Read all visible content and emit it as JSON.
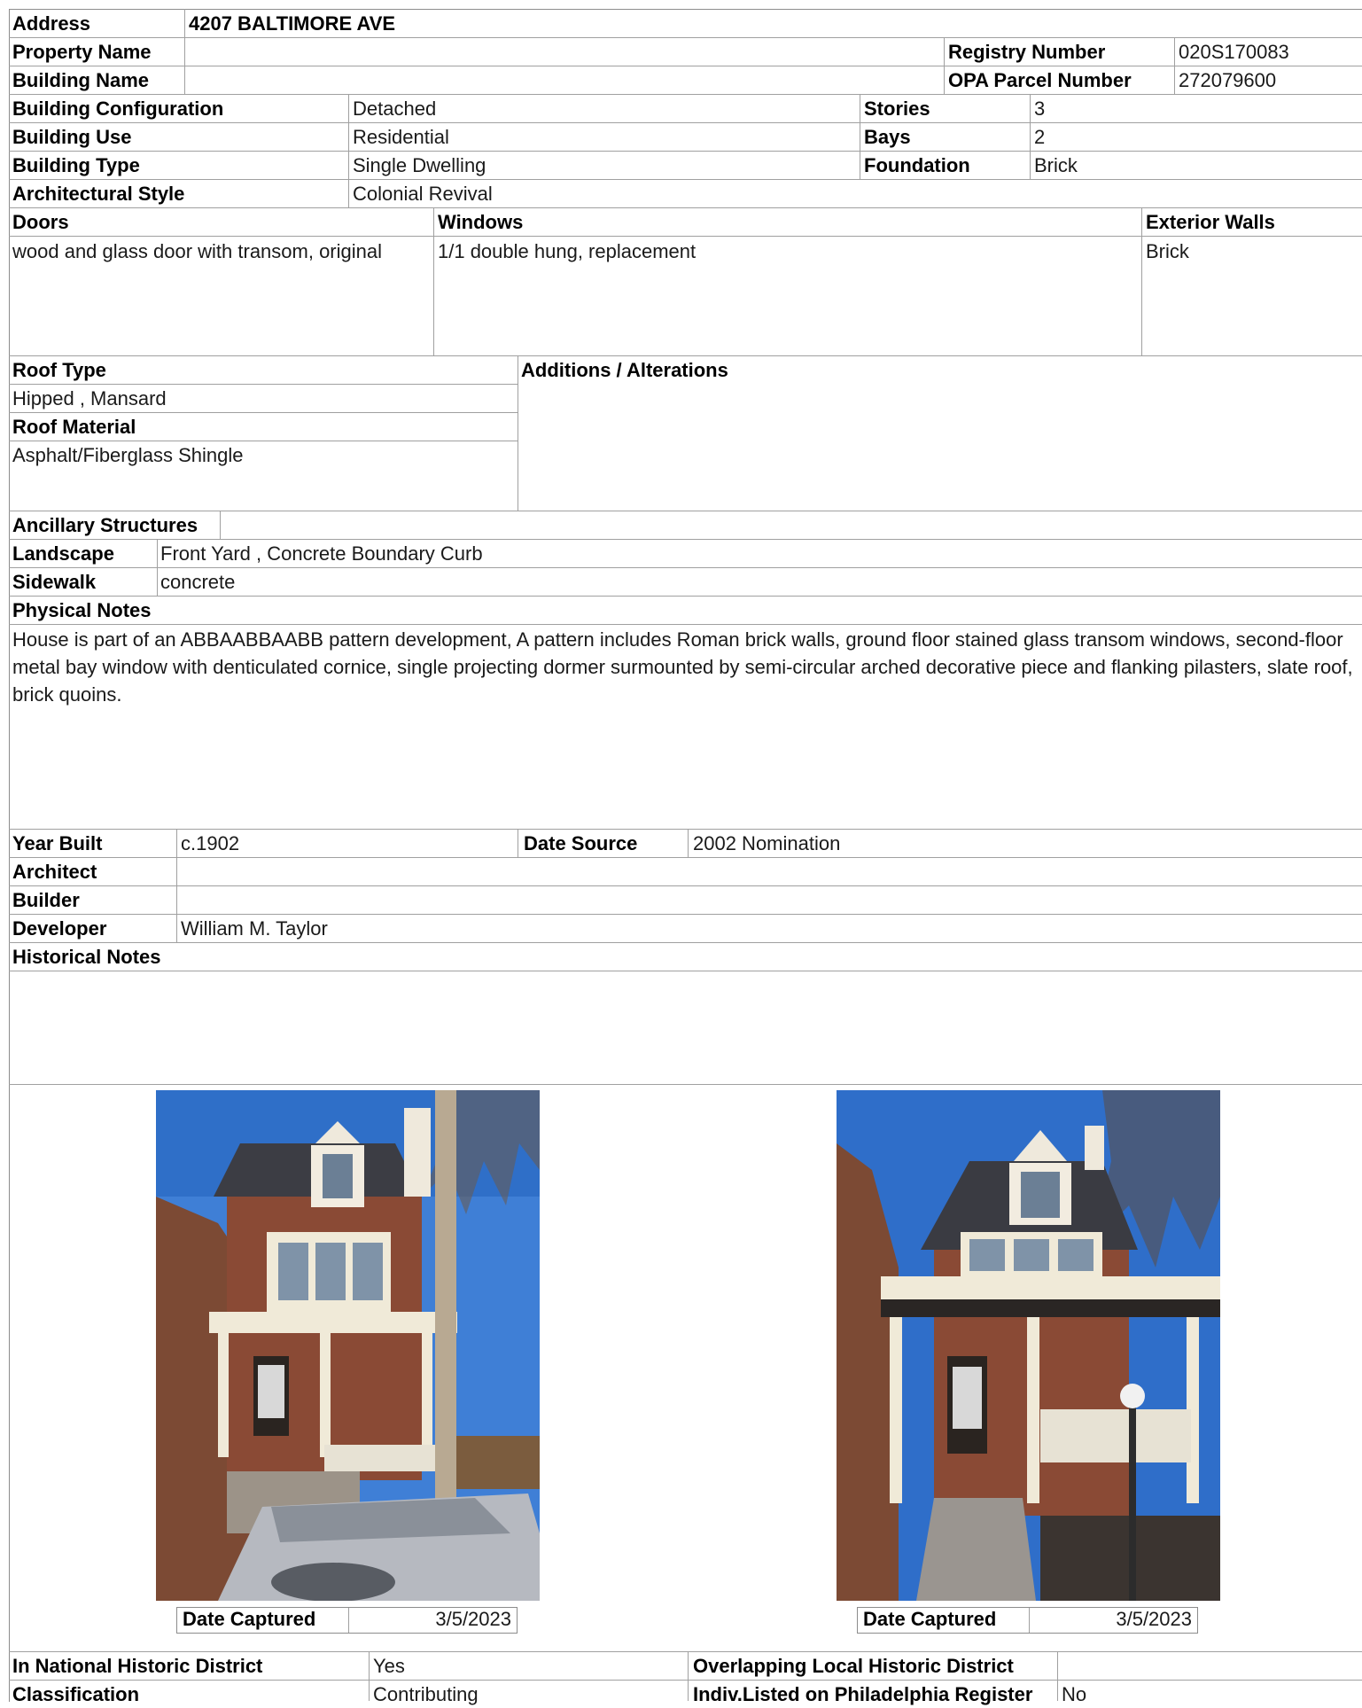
{
  "property": {
    "address_label": "Address",
    "address_value": "4207 BALTIMORE AVE",
    "property_name_label": "Property Name",
    "property_name_value": "",
    "registry_number_label": "Registry Number",
    "registry_number_value": "020S170083",
    "building_name_label": "Building Name",
    "building_name_value": "",
    "opa_parcel_label": "OPA Parcel Number",
    "opa_parcel_value": "272079600"
  },
  "building": {
    "configuration_label": "Building Configuration",
    "configuration_value": "Detached",
    "stories_label": "Stories",
    "stories_value": "3",
    "use_label": "Building Use",
    "use_value": "Residential",
    "bays_label": "Bays",
    "bays_value": "2",
    "type_label": "Building Type",
    "type_value": "Single Dwelling",
    "foundation_label": "Foundation",
    "foundation_value": "Brick",
    "style_label": "Architectural Style",
    "style_value": "Colonial Revival"
  },
  "features": {
    "doors_label": "Doors",
    "doors_value": "wood and glass door with transom, original",
    "windows_label": "Windows",
    "windows_value": "1/1 double hung, replacement",
    "walls_label": "Exterior Walls",
    "walls_value": "Brick"
  },
  "roof": {
    "type_label": "Roof Type",
    "type_value": "Hipped , Mansard",
    "material_label": "Roof Material",
    "material_value": "Asphalt/Fiberglass Shingle",
    "additions_label": "Additions / Alterations",
    "additions_value": ""
  },
  "site": {
    "ancillary_label": "Ancillary Structures",
    "ancillary_value": "",
    "landscape_label": "Landscape",
    "landscape_value": "Front Yard , Concrete Boundary Curb",
    "sidewalk_label": "Sidewalk",
    "sidewalk_value": "concrete"
  },
  "physical_notes": {
    "label": "Physical Notes",
    "text": "House is part of an ABBAABBAABB pattern development, A pattern includes Roman brick walls, ground floor stained glass transom windows, second-floor metal bay window with denticulated cornice, single projecting dormer surmounted by semi-circular arched decorative piece and flanking pilasters, slate roof, brick quoins."
  },
  "history": {
    "year_built_label": "Year Built",
    "year_built_value": "c.1902",
    "date_source_label": "Date Source",
    "date_source_value": "2002 Nomination",
    "architect_label": "Architect",
    "architect_value": "",
    "builder_label": "Builder",
    "builder_value": "",
    "developer_label": "Developer",
    "developer_value": "William M. Taylor",
    "notes_label": "Historical Notes",
    "notes_value": ""
  },
  "photos": [
    {
      "caption_label": "Date Captured",
      "caption_value": "3/5/2023"
    },
    {
      "caption_label": "Date Captured",
      "caption_value": "3/5/2023"
    }
  ],
  "district": {
    "national_label": "In National Historic District",
    "national_value": "Yes",
    "local_label": "Overlapping Local Historic District",
    "local_value": "",
    "classification_label": "Classification",
    "classification_value": "Contributing",
    "indiv_label": "Indiv.Listed on Philadelphia Register",
    "indiv_value": "No"
  }
}
